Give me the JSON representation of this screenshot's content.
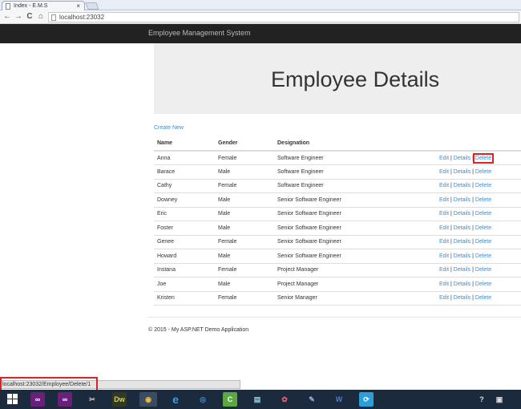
{
  "browser": {
    "tab_title": "Index - E.M.S",
    "tab_close": "×",
    "url": "localhost:23032",
    "back": "←",
    "forward": "→",
    "reload": "C",
    "home": "⌂"
  },
  "site": {
    "brand": "Employee Management System",
    "heading": "Employee Details",
    "create_link": "Create New",
    "footer": "© 2015 - My ASP.NET Demo Application"
  },
  "table": {
    "headers": [
      "Name",
      "Gender",
      "Designation"
    ],
    "rows": [
      {
        "name": "Anna",
        "gender": "Female",
        "designation": "Software Engineer"
      },
      {
        "name": "Barace",
        "gender": "Male",
        "designation": "Software Engineer"
      },
      {
        "name": "Cathy",
        "gender": "Female",
        "designation": "Software Engineer"
      },
      {
        "name": "Downey",
        "gender": "Male",
        "designation": "Senior Software Engineer"
      },
      {
        "name": "Eric",
        "gender": "Male",
        "designation": "Senior Software Engineer"
      },
      {
        "name": "Foster",
        "gender": "Male",
        "designation": "Senior Software Engineer"
      },
      {
        "name": "Genee",
        "gender": "Female",
        "designation": "Senior Software Engineer"
      },
      {
        "name": "Howard",
        "gender": "Male",
        "designation": "Senior Software Engineer"
      },
      {
        "name": "Instana",
        "gender": "Female",
        "designation": "Project Manager"
      },
      {
        "name": "Joe",
        "gender": "Male",
        "designation": "Project Manager"
      },
      {
        "name": "Kristen",
        "gender": "Female",
        "designation": "Senior Manager"
      }
    ],
    "actions": {
      "edit": "Edit",
      "details": "Details",
      "delete": "Delete",
      "separator": " | "
    }
  },
  "status_bar": "localhost:23032/Employee/Delete/1",
  "taskbar": {
    "icons": [
      "windows-start",
      "visual-studio",
      "visual-studio",
      "tools",
      "dreamweaver",
      "chrome",
      "internet-explorer",
      "media-player",
      "camtasia",
      "notepad",
      "paint",
      "settings",
      "word",
      "app"
    ],
    "dreamweaver_label": "Dw",
    "camtasia_label": "C",
    "word_label": "W"
  }
}
